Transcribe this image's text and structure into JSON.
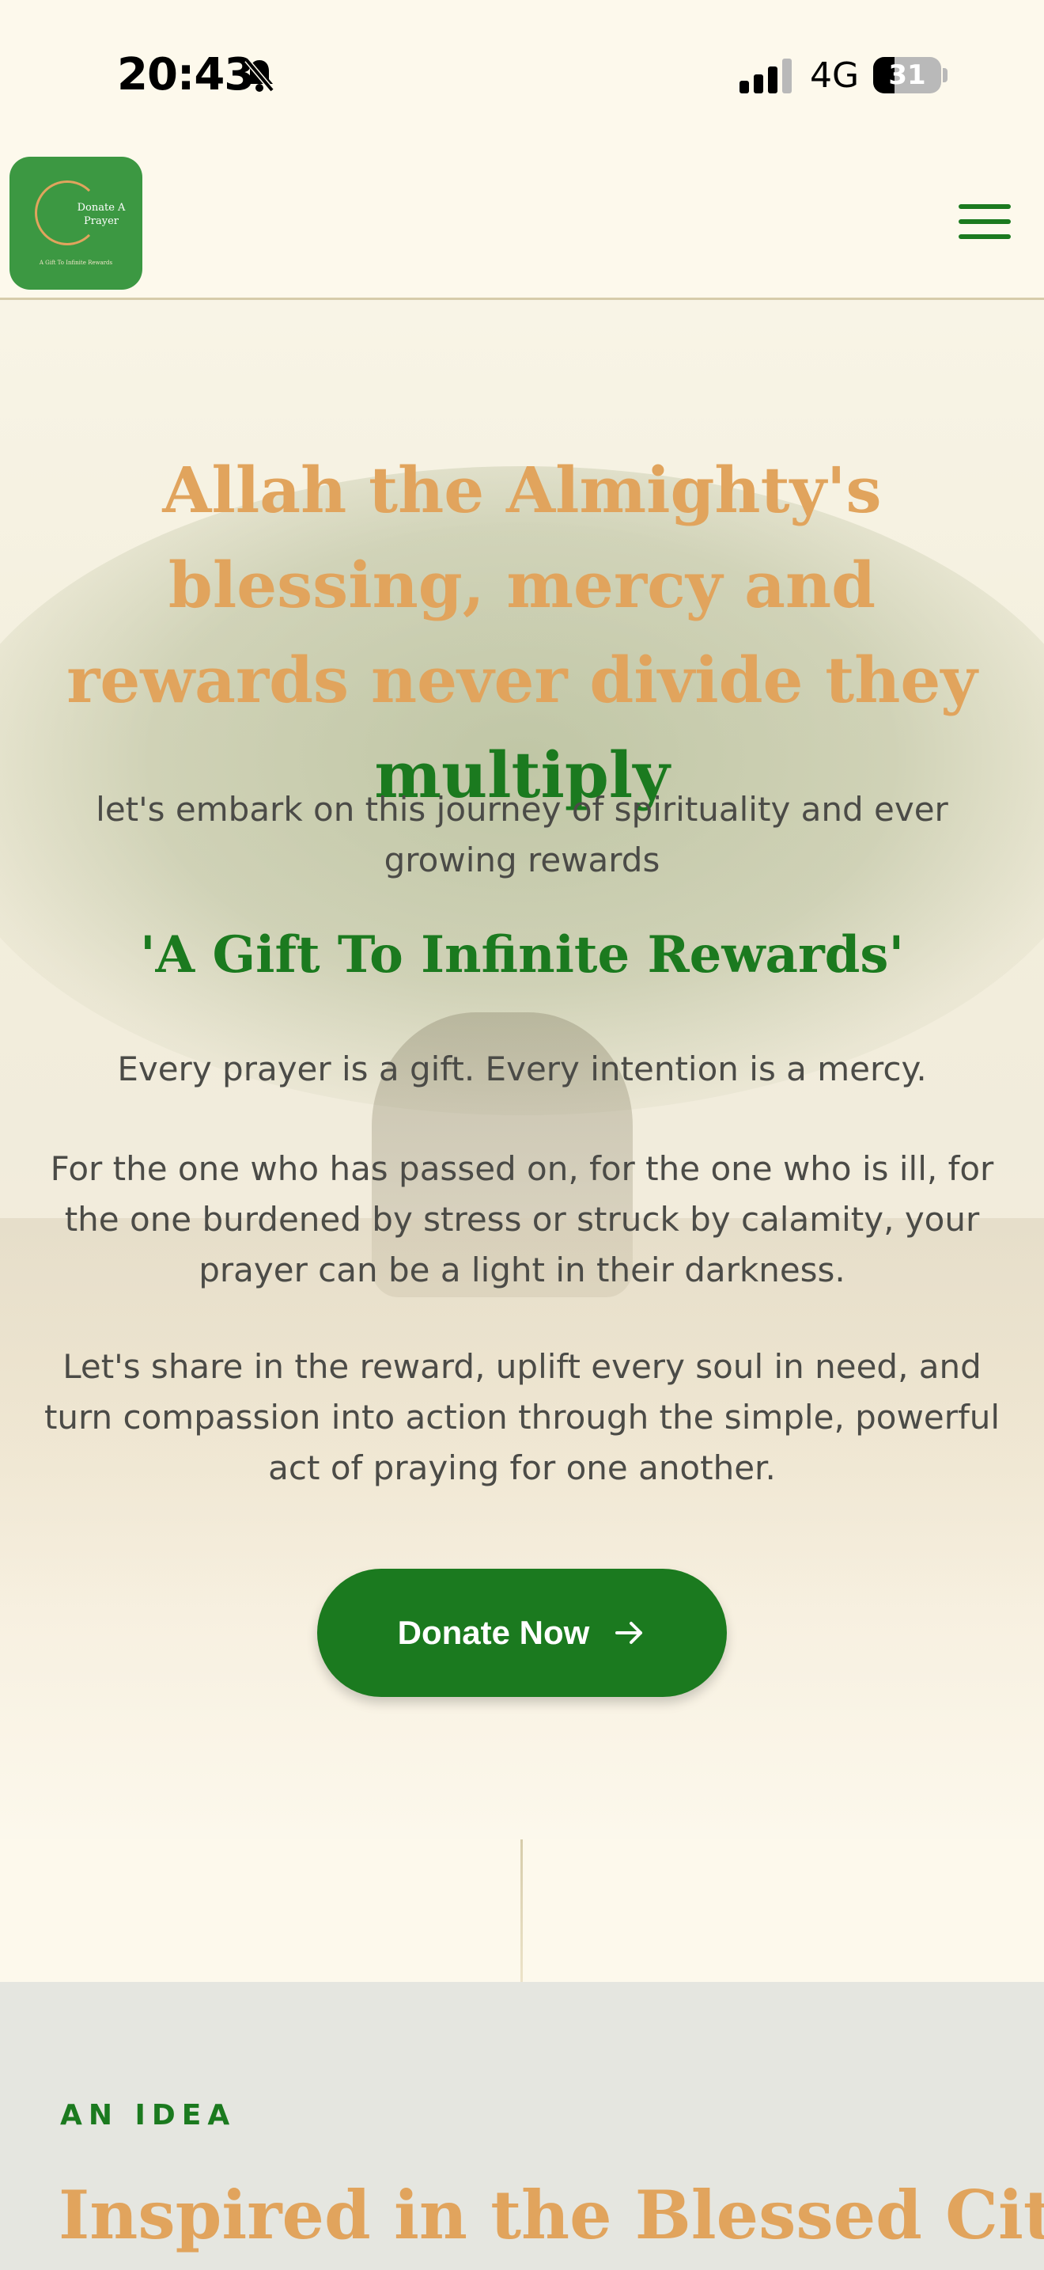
{
  "status_bar": {
    "time": "20:43",
    "network": "4G",
    "battery": "31",
    "battery_level": 0.31,
    "icons": [
      "bell-slash-icon",
      "signal-icon",
      "battery-icon"
    ]
  },
  "header": {
    "logo": {
      "title_line1": "Donate A",
      "title_line2": "Prayer",
      "tagline": "A Gift To Infinite Rewards"
    },
    "menu_icon": "hamburger-icon"
  },
  "hero": {
    "title_main": "Allah the Almighty's blessing, mercy and rewards never divide they",
    "title_accent": "multiply",
    "subtitle": "let's embark on this journey of spirituality and ever growing rewards",
    "quote": "'A Gift To Infinite Rewards'",
    "paragraph1": "Every prayer is a gift. Every intention is a mercy.",
    "paragraph2": "For the one who has passed on, for the one who is ill, for the one burdened by stress or struck by calamity, your prayer can be a light in their darkness.",
    "paragraph3": "Let's share in the reward, uplift every soul in need, and turn compassion into action through the simple, powerful act of praying for one another.",
    "cta_label": "Donate Now",
    "cta_icon": "arrow-right-icon"
  },
  "idea_section": {
    "eyebrow": "AN IDEA",
    "title": "Inspired in the Blessed City"
  },
  "colors": {
    "page_background": "#fdf9ec",
    "brand_green": "#1b7a1f",
    "accent_gold": "#e1a45d",
    "logo_green": "#3c9842",
    "body_text": "#4b4b47",
    "section_grey": "#e5e6e0"
  }
}
